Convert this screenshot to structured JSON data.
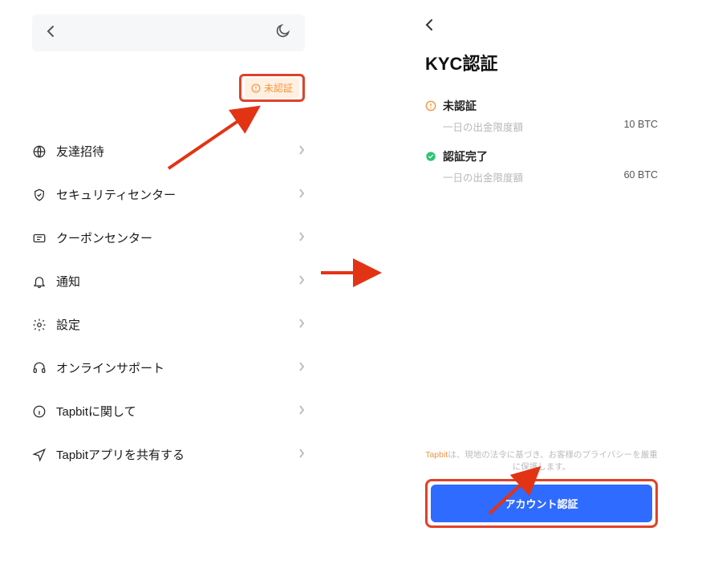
{
  "left": {
    "badge": "未認証",
    "items": [
      {
        "icon": "globe-icon",
        "label": "友達招待"
      },
      {
        "icon": "shield-icon",
        "label": "セキュリティセンター"
      },
      {
        "icon": "coupon-icon",
        "label": "クーポンセンター"
      },
      {
        "icon": "bell-icon",
        "label": "通知"
      },
      {
        "icon": "gear-icon",
        "label": "設定"
      },
      {
        "icon": "headset-icon",
        "label": "オンラインサポート"
      },
      {
        "icon": "info-icon",
        "label": "Tapbitに関して"
      },
      {
        "icon": "send-icon",
        "label": "Tapbitアプリを共有する"
      }
    ]
  },
  "right": {
    "title": "KYC認証",
    "tiers": [
      {
        "status_icon": "alert-icon",
        "name": "未認証",
        "sub_label": "一日の出金限度額",
        "value": "10 BTC"
      },
      {
        "status_icon": "verify-icon",
        "name": "認証完了",
        "sub_label": "一日の出金限度額",
        "value": "60 BTC"
      }
    ],
    "disclaimer_brand": "Tapbit",
    "disclaimer_text": "は、現地の法令に基づき、お客様のプライバシーを厳重に保護します。",
    "cta": "アカウント認証"
  },
  "colors": {
    "accent_orange": "#f3943e",
    "accent_blue": "#2f6bff",
    "highlight_red": "#e04128"
  }
}
